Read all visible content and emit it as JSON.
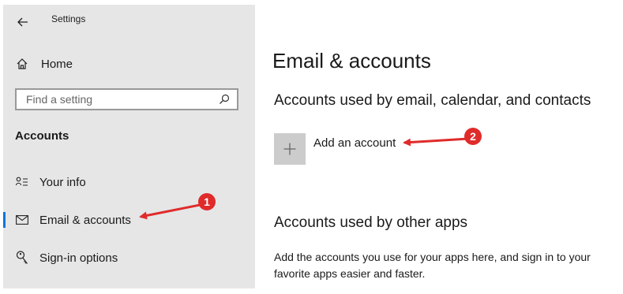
{
  "window": {
    "title": "Settings",
    "back_icon": "back-arrow-icon"
  },
  "sidebar": {
    "home_label": "Home",
    "search_placeholder": "Find a setting",
    "section_heading": "Accounts",
    "items": [
      {
        "label": "Your info",
        "icon": "person-card-icon",
        "selected": false
      },
      {
        "label": "Email & accounts",
        "icon": "mail-icon",
        "selected": true
      },
      {
        "label": "Sign-in options",
        "icon": "key-icon",
        "selected": false
      }
    ]
  },
  "main": {
    "title": "Email & accounts",
    "email_section_heading": "Accounts used by email, calendar, and contacts",
    "add_account_label": "Add an account",
    "other_apps_heading": "Accounts used by other apps",
    "other_apps_description": "Add the accounts you use for your apps here, and sign in to your favorite apps easier and faster."
  },
  "annotations": [
    {
      "number": "1",
      "color": "#e02b2b"
    },
    {
      "number": "2",
      "color": "#e02b2b"
    }
  ],
  "colors": {
    "accent": "#0078d7",
    "sidebar_bg": "#e6e6e6",
    "tile_bg": "#cccccc",
    "annotation": "#e02b2b"
  }
}
